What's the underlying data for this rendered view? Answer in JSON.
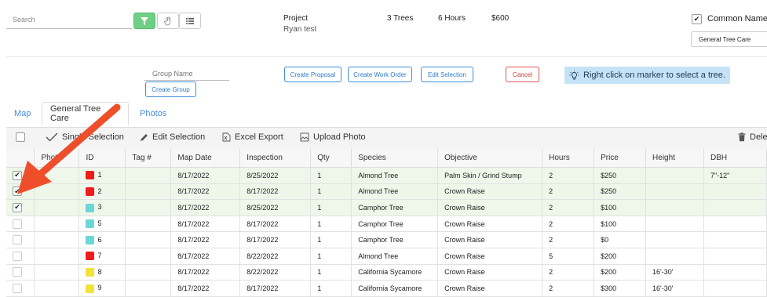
{
  "search": {
    "placeholder": "Search"
  },
  "project": {
    "label": "Project",
    "name": "Ryan test",
    "trees": "3 Trees",
    "hours": "6 Hours",
    "price": "$600"
  },
  "common_name": {
    "label": "Common Name",
    "checked": true,
    "dropdown": "General Tree Care"
  },
  "group": {
    "name_placeholder": "Group Name",
    "create_group": "Create Group"
  },
  "actions": {
    "create_proposal": "Create Proposal",
    "create_work_order": "Create Work Order",
    "edit_selection": "Edit Selection",
    "cancel": "Cancel"
  },
  "hint": "Right click on marker to select a tree.",
  "tabs": [
    "Map",
    "General Tree Care",
    "Photos"
  ],
  "toolbar": {
    "single_selection": "Single Selection",
    "edit_selection": "Edit Selection",
    "excel_export": "Excel Export",
    "upload_photo": "Upload Photo",
    "delete": "Dele"
  },
  "table": {
    "columns": [
      "Photo",
      "ID",
      "Tag #",
      "Map Date",
      "Inspection",
      "Qty",
      "Species",
      "Objective",
      "Hours",
      "Price",
      "Height",
      "DBH"
    ],
    "rows": [
      {
        "checked": true,
        "color": "#ef1c1c",
        "id": "1",
        "tag": "",
        "map_date": "8/17/2022",
        "inspection": "8/25/2022",
        "qty": "1",
        "species": "Almond Tree",
        "objective": "Palm Skin / Grind Stump",
        "hours": "2",
        "price": "$250",
        "height": "",
        "dbh": "7\"-12\""
      },
      {
        "checked": true,
        "color": "#ef1c1c",
        "id": "2",
        "tag": "",
        "map_date": "8/17/2022",
        "inspection": "8/17/2022",
        "qty": "1",
        "species": "Almond Tree",
        "objective": "Crown Raise",
        "hours": "2",
        "price": "$250",
        "height": "",
        "dbh": ""
      },
      {
        "checked": true,
        "color": "#6dd6d8",
        "id": "3",
        "tag": "",
        "map_date": "8/17/2022",
        "inspection": "8/25/2022",
        "qty": "1",
        "species": "Camphor Tree",
        "objective": "Crown Raise",
        "hours": "2",
        "price": "$100",
        "height": "",
        "dbh": ""
      },
      {
        "checked": false,
        "color": "#6dd6d8",
        "id": "5",
        "tag": "",
        "map_date": "8/17/2022",
        "inspection": "8/17/2022",
        "qty": "1",
        "species": "Camphor Tree",
        "objective": "Crown Raise",
        "hours": "2",
        "price": "$100",
        "height": "",
        "dbh": ""
      },
      {
        "checked": false,
        "color": "#6dd6d8",
        "id": "6",
        "tag": "",
        "map_date": "8/17/2022",
        "inspection": "8/17/2022",
        "qty": "1",
        "species": "Camphor Tree",
        "objective": "Crown Raise",
        "hours": "2",
        "price": "$0",
        "height": "",
        "dbh": ""
      },
      {
        "checked": false,
        "color": "#ef1c1c",
        "id": "7",
        "tag": "",
        "map_date": "8/17/2022",
        "inspection": "8/22/2022",
        "qty": "1",
        "species": "Almond Tree",
        "objective": "Crown Raise",
        "hours": "5",
        "price": "$200",
        "height": "",
        "dbh": ""
      },
      {
        "checked": false,
        "color": "#f2e23a",
        "id": "8",
        "tag": "",
        "map_date": "8/17/2022",
        "inspection": "8/22/2022",
        "qty": "1",
        "species": "California Sycamore",
        "objective": "Crown Raise",
        "hours": "2",
        "price": "$200",
        "height": "16'-30'",
        "dbh": ""
      },
      {
        "checked": false,
        "color": "#f2e23a",
        "id": "9",
        "tag": "",
        "map_date": "8/17/2022",
        "inspection": "8/17/2022",
        "qty": "1",
        "species": "California Sycamore",
        "objective": "Crown Raise",
        "hours": "2",
        "price": "$300",
        "height": "16'-30'",
        "dbh": ""
      }
    ]
  },
  "colors": {
    "accent": "#4a8de0",
    "arrow": "#ee4e2a",
    "filter_green": "#6fcf84",
    "hint_bg": "#c5e3f6"
  }
}
